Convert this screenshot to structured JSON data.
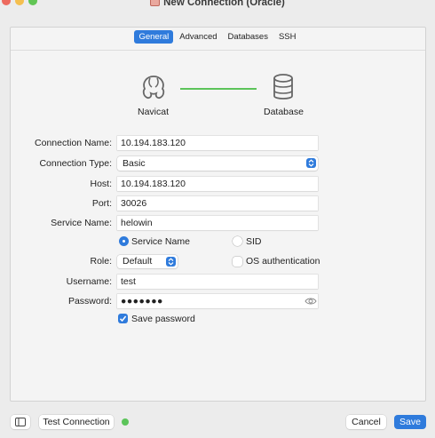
{
  "window": {
    "title": "New Connection (Oracle)"
  },
  "tabs": [
    {
      "label": "General",
      "active": true
    },
    {
      "label": "Advanced",
      "active": false
    },
    {
      "label": "Databases",
      "active": false
    },
    {
      "label": "SSH",
      "active": false
    }
  ],
  "diagram": {
    "source_label": "Navicat",
    "target_label": "Database",
    "link_color": "#5cc45a"
  },
  "form": {
    "connection_name": {
      "label": "Connection Name:",
      "value": "10.194.183.120"
    },
    "connection_type": {
      "label": "Connection Type:",
      "value": "Basic"
    },
    "host": {
      "label": "Host:",
      "value": "10.194.183.120"
    },
    "port": {
      "label": "Port:",
      "value": "30026"
    },
    "service_name": {
      "label": "Service Name:",
      "value": "helowin"
    },
    "service_type_options": {
      "service_name": {
        "label": "Service Name",
        "selected": true
      },
      "sid": {
        "label": "SID",
        "selected": false
      }
    },
    "role": {
      "label": "Role:",
      "value": "Default"
    },
    "os_authentication": {
      "label": "OS authentication",
      "checked": false
    },
    "username": {
      "label": "Username:",
      "value": "test"
    },
    "password": {
      "label": "Password:",
      "value": "●●●●●●●"
    },
    "save_password": {
      "label": "Save password",
      "checked": true
    }
  },
  "footer": {
    "test_connection_label": "Test Connection",
    "status_color": "#5cc45a",
    "cancel_label": "Cancel",
    "save_label": "Save"
  },
  "colors": {
    "accent": "#2f7bdc"
  }
}
